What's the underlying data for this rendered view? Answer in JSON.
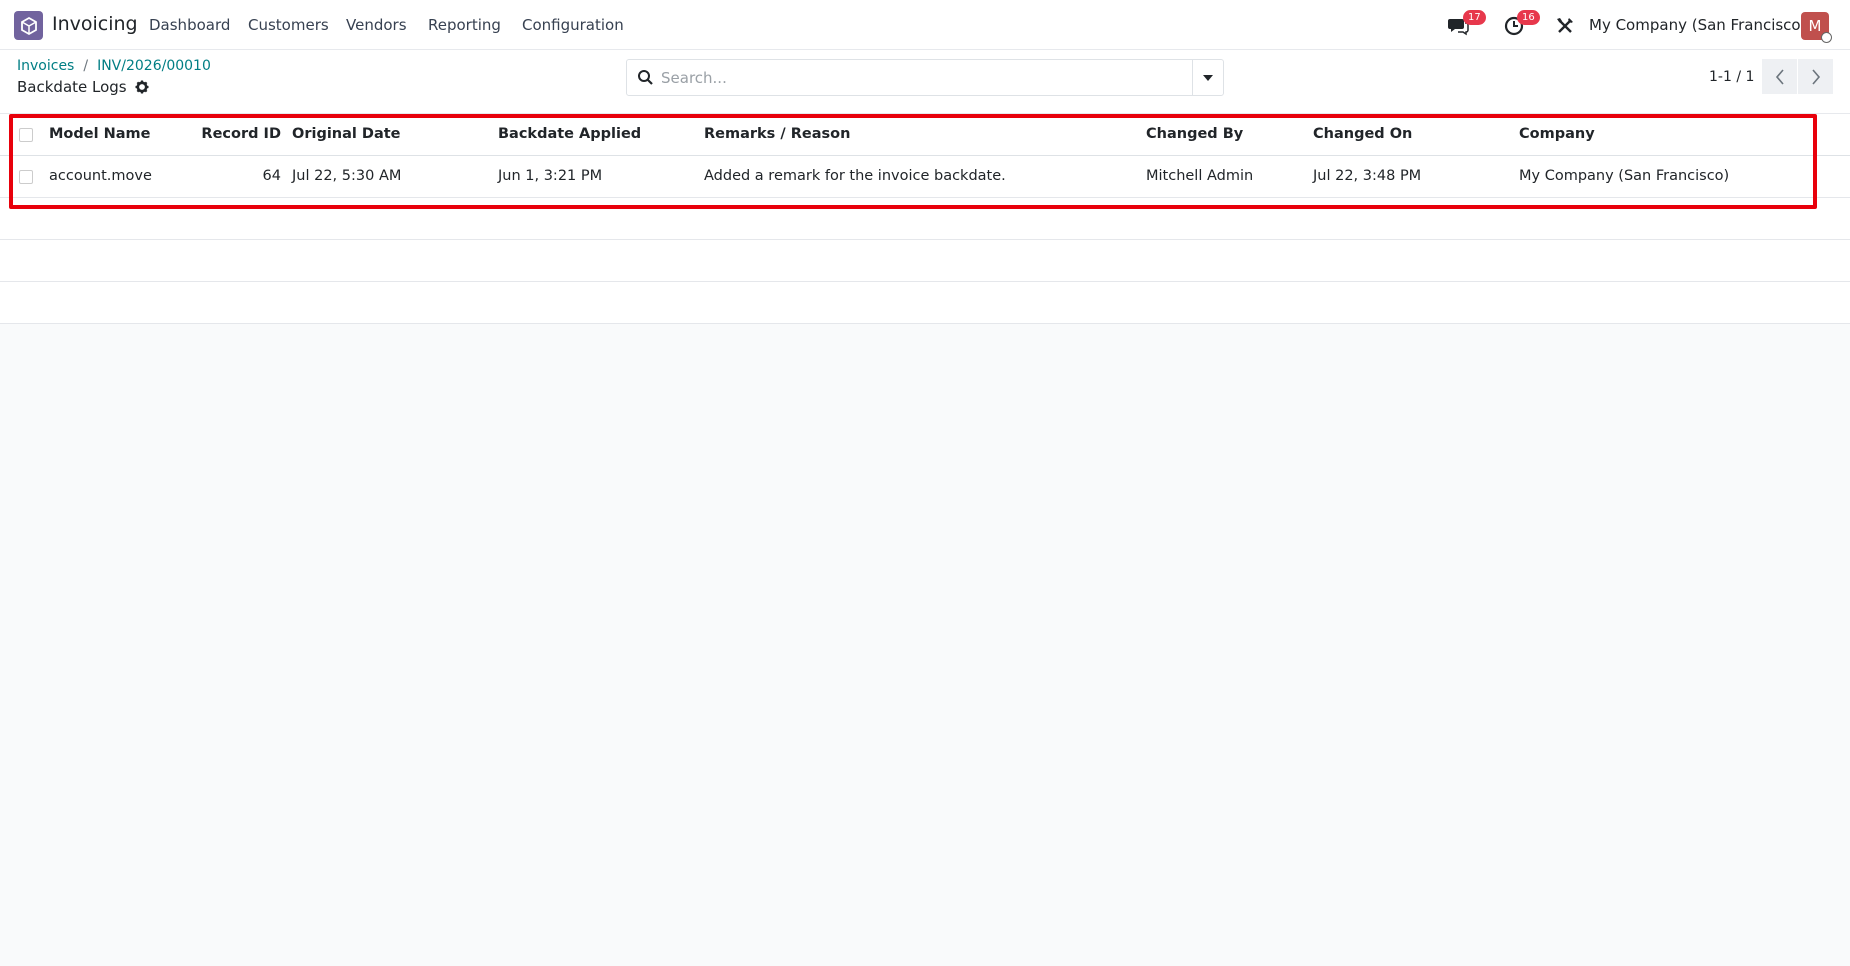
{
  "navbar": {
    "app_name": "Invoicing",
    "menu": [
      "Dashboard",
      "Customers",
      "Vendors",
      "Reporting",
      "Configuration"
    ],
    "messages_count": "17",
    "activities_count": "16",
    "company": "My Company (San Francisco)",
    "avatar_letter": "M"
  },
  "breadcrumb": {
    "items": [
      "Invoices",
      "INV/2026/00010"
    ],
    "separator": "/",
    "current": "Backdate Logs"
  },
  "search": {
    "placeholder": "Search..."
  },
  "pager": {
    "value": "1-1 / 1"
  },
  "table": {
    "columns": [
      "Model Name",
      "Record ID",
      "Original Date",
      "Backdate Applied",
      "Remarks / Reason",
      "Changed By",
      "Changed On",
      "Company"
    ],
    "rows": [
      {
        "model_name": "account.move",
        "record_id": "64",
        "original_date": "Jul 22, 5:30 AM",
        "backdate_applied": "Jun 1, 3:21 PM",
        "remarks": "Added a remark for the invoice backdate.",
        "changed_by": "Mitchell Admin",
        "changed_on": "Jul 22, 3:48 PM",
        "company": "My Company (San Francisco)"
      }
    ]
  },
  "colors": {
    "brand": "#71639e",
    "link": "#017e84",
    "badge": "#e7384c",
    "highlight": "#e8000b"
  }
}
